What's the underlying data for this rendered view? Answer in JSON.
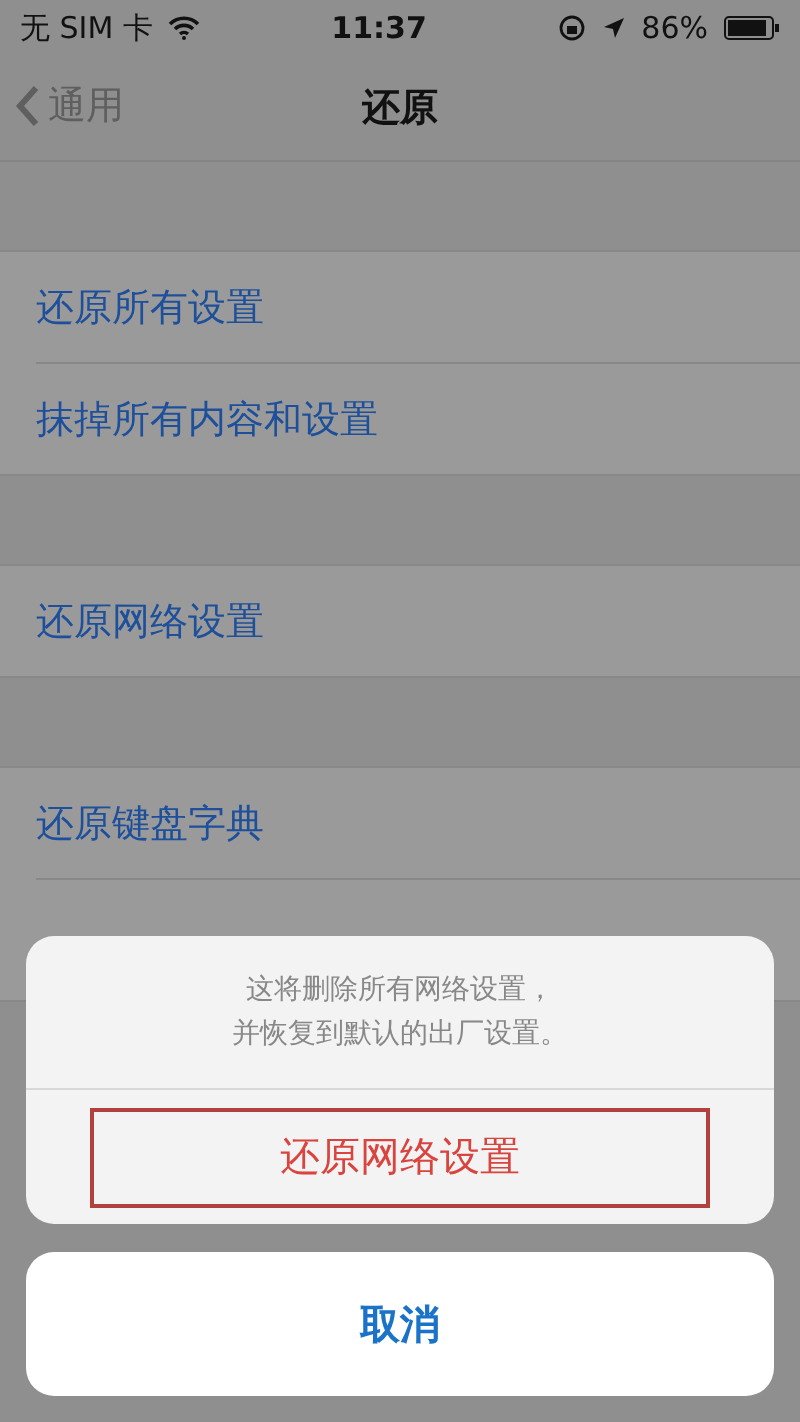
{
  "status_bar": {
    "carrier": "无 SIM 卡",
    "time": "11:37",
    "battery": "86%"
  },
  "nav": {
    "back": "通用",
    "title": "还原"
  },
  "groups": [
    {
      "items": [
        "还原所有设置",
        "抹掉所有内容和设置"
      ]
    },
    {
      "items": [
        "还原网络设置"
      ]
    },
    {
      "items": [
        "还原键盘字典"
      ]
    }
  ],
  "action_sheet": {
    "message": [
      "这将删除所有网络设置，",
      "并恢复到默认的出厂设置。"
    ],
    "actions": [
      {
        "label": "还原网络设置",
        "kind": "destructive",
        "highlighted": true
      }
    ],
    "cancel": "取消"
  }
}
